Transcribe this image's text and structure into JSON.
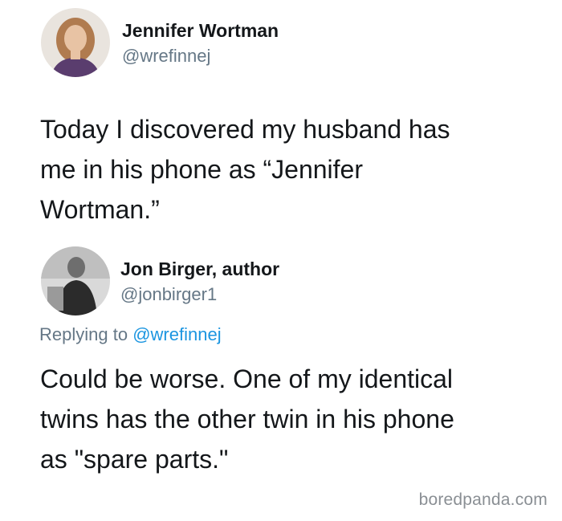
{
  "tweets": [
    {
      "name": "Jennifer Wortman",
      "handle": "@wrefinnej",
      "text_lines": [
        "Today I discovered my husband has",
        "me in his phone as “Jennifer",
        "Wortman.”"
      ]
    },
    {
      "name": "Jon Birger, author",
      "handle": "@jonbirger1",
      "replying_prefix": "Replying to",
      "replying_to": "@wrefinnej",
      "text_lines": [
        "Could be worse. One of my identical",
        "twins has the other twin in his phone",
        "as \"spare parts.\""
      ]
    }
  ],
  "watermark": "boredpanda.com",
  "colors": {
    "text": "#14171a",
    "muted": "#657786",
    "link": "#1b95e0"
  }
}
